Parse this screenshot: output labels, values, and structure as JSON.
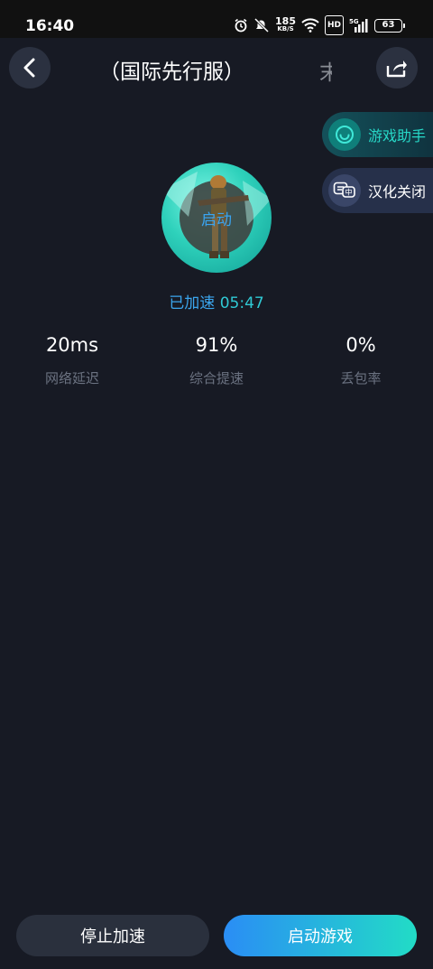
{
  "status_bar": {
    "time": "16:40",
    "net_speed_value": "185",
    "net_speed_unit": "KB/S",
    "hd_label": "HD",
    "network_label": "5G",
    "battery": "63"
  },
  "header": {
    "title": "（国际先行服）",
    "title_overflow": "末"
  },
  "side_menu": {
    "assistant_label": "游戏助手",
    "localization_label": "汉化关闭"
  },
  "game": {
    "start_label": "启动",
    "accel_status_label": "已加速",
    "accel_time": "05:47"
  },
  "stats": [
    {
      "value": "20ms",
      "label": "网络延迟"
    },
    {
      "value": "91%",
      "label": "综合提速"
    },
    {
      "value": "0%",
      "label": "丢包率"
    }
  ],
  "buttons": {
    "stop_label": "停止加速",
    "launch_label": "启动游戏"
  },
  "colors": {
    "background": "#171a24",
    "accent_teal": "#27d8c7",
    "accent_blue": "#3ba6ee",
    "launch_gradient_start": "#2a8df5",
    "launch_gradient_end": "#22dcc6"
  }
}
